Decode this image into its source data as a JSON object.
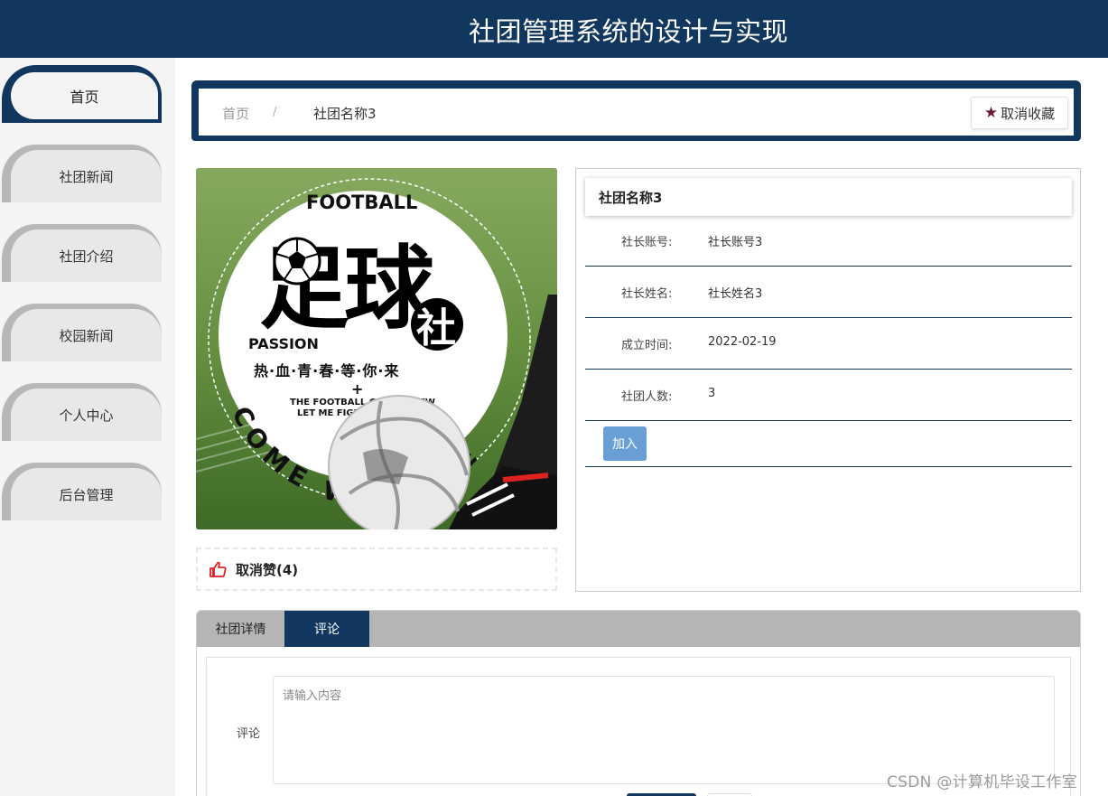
{
  "header": {
    "title": "社团管理系统的设计与实现"
  },
  "sidebar": {
    "items": [
      {
        "label": "首页",
        "active": true
      },
      {
        "label": "社团新闻",
        "active": false
      },
      {
        "label": "社团介绍",
        "active": false
      },
      {
        "label": "校园新闻",
        "active": false
      },
      {
        "label": "个人中心",
        "active": false
      },
      {
        "label": "后台管理",
        "active": false
      }
    ]
  },
  "breadcrumb": {
    "home": "首页",
    "separator": "/",
    "current": "社团名称3"
  },
  "favorite": {
    "icon": "star-icon",
    "label": "取消收藏"
  },
  "poster": {
    "text_football": "FOOTBALL",
    "text_main": "足球",
    "text_she": "社",
    "text_passion": "PASSION",
    "text_slogan": "热·血·青·春·等·你·来",
    "text_plus": "+",
    "text_en1": "THE FOOTBALL CLUB IS NEW",
    "text_en2": "LET ME FIGHT TOGETHER",
    "text_come": "COME WITH ME"
  },
  "like": {
    "icon": "thumbs-up-icon",
    "label": "取消赞(4)"
  },
  "club": {
    "name": "社团名称3",
    "fields": [
      {
        "key": "社长账号:",
        "value": "社长账号3"
      },
      {
        "key": "社长姓名:",
        "value": "社长姓名3"
      },
      {
        "key": "成立时间:",
        "value": "2022-02-19"
      },
      {
        "key": "社团人数:",
        "value": "3"
      }
    ],
    "join_label": "加入"
  },
  "tabs": [
    {
      "label": "社团详情",
      "active": false
    },
    {
      "label": "评论",
      "active": true
    }
  ],
  "comment": {
    "label": "评论",
    "placeholder": "请输入内容",
    "value": ""
  },
  "watermark": "CSDN @计算机毕设工作室",
  "colors": {
    "primary": "#11375e",
    "join_button": "#6a9fd6",
    "star": "#6b1a3a",
    "like_icon": "#e02020"
  }
}
